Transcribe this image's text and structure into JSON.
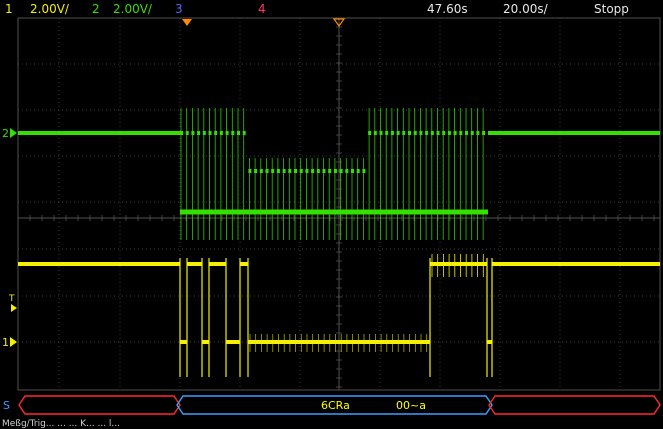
{
  "header": {
    "ch1": {
      "num": "1",
      "scale": "2.00V/",
      "color": "#f4f000"
    },
    "ch2": {
      "num": "2",
      "scale": "2.00V/",
      "color": "#33e000"
    },
    "ch3": {
      "num": "3",
      "color": "#5566ff"
    },
    "ch4": {
      "num": "4",
      "color": "#ff3366"
    },
    "trigger_time": "47.60s",
    "timebase": "20.00s/",
    "run_state": "Stopp"
  },
  "markers": {
    "ch2_ground": "2",
    "ch1_ground": "1",
    "trigger_level": "T",
    "serial_label": "S"
  },
  "serial_bus": {
    "packet_left": "6CRa",
    "packet_right": "00~a",
    "colors": {
      "error": "#ff2a2a",
      "data": "#3aa0ff",
      "data_text": "#ffff00"
    }
  },
  "footer": {
    "text": "Meßg/Trig...  ...  ...  K...  ...  l..."
  },
  "colors": {
    "grid": "#505050",
    "ch1_trace": "#f4f000",
    "ch2_trace": "#33e000",
    "trigger_marker": "#ff8800"
  }
}
